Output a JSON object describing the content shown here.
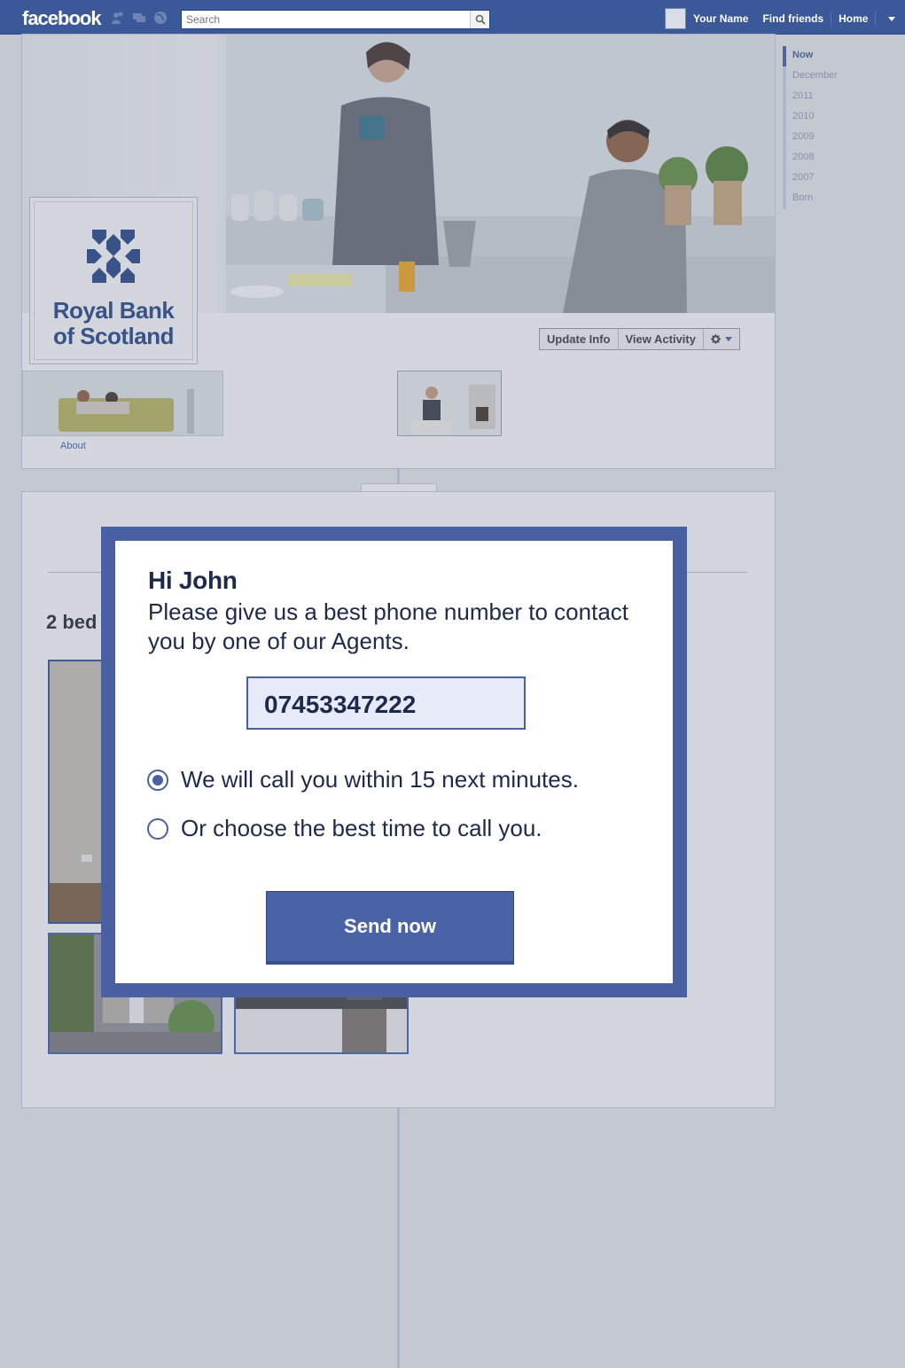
{
  "topbar": {
    "logo": "facebook",
    "search_placeholder": "Search",
    "user_name": "Your Name",
    "find_friends": "Find friends",
    "home": "Home"
  },
  "timeline_nav": {
    "items": [
      "Now",
      "December",
      "2011",
      "2010",
      "2009",
      "2008",
      "2007",
      "Born"
    ],
    "active": "Now"
  },
  "profile": {
    "page_name_line1": "Royal Bank",
    "page_name_line2": "of Scotland",
    "update_info": "Update Info",
    "view_activity": "View Activity",
    "about_link": "About"
  },
  "post": {
    "heading": "2 bed"
  },
  "modal": {
    "title": "Hi John",
    "message": "Please give us a best phone number to contact you by one of our Agents.",
    "phone_value": "07453347222",
    "option1": "We will call you within 15 next minutes.",
    "option2": "Or choose the best time to call you.",
    "selected_option": 1,
    "send_button": "Send now"
  },
  "colors": {
    "brand": "#3b5998",
    "modal_frame": "#4960a2",
    "rbs_navy": "#1d3d82"
  }
}
